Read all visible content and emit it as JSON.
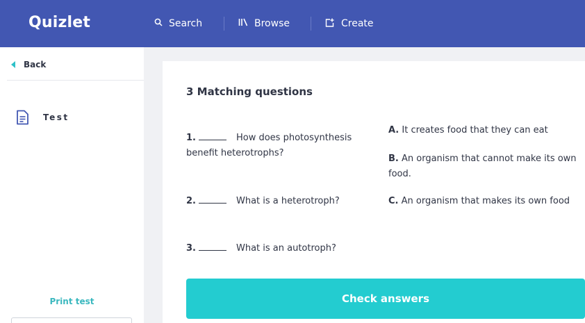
{
  "header": {
    "logo": "Quizlet",
    "nav": [
      {
        "label": "Search",
        "icon": "search-icon"
      },
      {
        "label": "Browse",
        "icon": "browse-icon"
      },
      {
        "label": "Create",
        "icon": "create-icon"
      }
    ],
    "bg_color": "#4257b2"
  },
  "sidebar": {
    "back_label": "Back",
    "test_label": "Test",
    "print_label": "Print test"
  },
  "main": {
    "title": "3 Matching questions",
    "questions": [
      {
        "number": "1.",
        "text": "How does photosynthesis benefit heterotrophs?"
      },
      {
        "number": "2.",
        "text": "What is a heterotroph?"
      },
      {
        "number": "3.",
        "text": "What is an autotroph?"
      }
    ],
    "answers": [
      {
        "letter": "A.",
        "text": "It creates food that they can eat"
      },
      {
        "letter": "B.",
        "text": "An organism that cannot make its own food."
      },
      {
        "letter": "C.",
        "text": "An organism that makes its own food"
      }
    ],
    "check_button": "Check answers",
    "accent_color": "#23ccd0"
  }
}
